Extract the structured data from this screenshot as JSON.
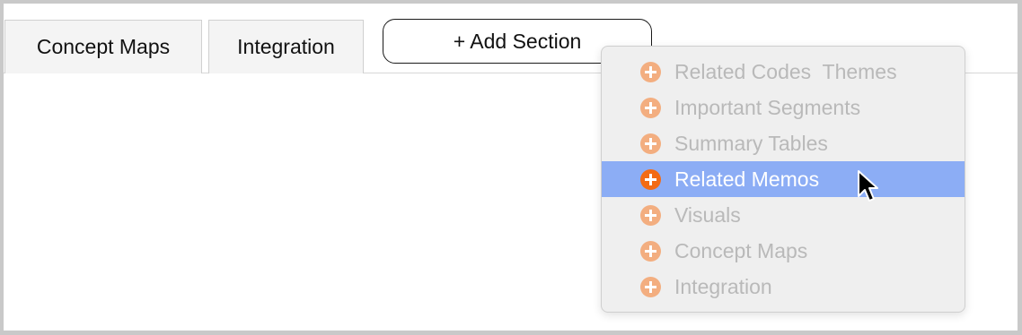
{
  "tabs": [
    {
      "label": "Concept Maps"
    },
    {
      "label": "Integration"
    }
  ],
  "add_section": {
    "label": "+ Add Section"
  },
  "menu": {
    "items": [
      {
        "label": "Related Codes  Themes",
        "icon": "plus-circle-icon",
        "state": "disabled"
      },
      {
        "label": "Important Segments",
        "icon": "plus-circle-icon",
        "state": "disabled"
      },
      {
        "label": "Summary Tables",
        "icon": "plus-circle-icon",
        "state": "disabled"
      },
      {
        "label": "Related Memos",
        "icon": "plus-circle-icon",
        "state": "highlighted"
      },
      {
        "label": "Visuals",
        "icon": "plus-circle-icon",
        "state": "disabled"
      },
      {
        "label": "Concept Maps",
        "icon": "plus-circle-icon",
        "state": "disabled"
      },
      {
        "label": "Integration",
        "icon": "plus-circle-icon",
        "state": "disabled"
      }
    ]
  },
  "colors": {
    "highlight": "#8cadf5",
    "icon_active": "#f36b14",
    "icon_inactive": "#f3ae80",
    "disabled_text": "#b9b9b9"
  },
  "cursor": {
    "icon": "arrow-pointer-icon"
  }
}
